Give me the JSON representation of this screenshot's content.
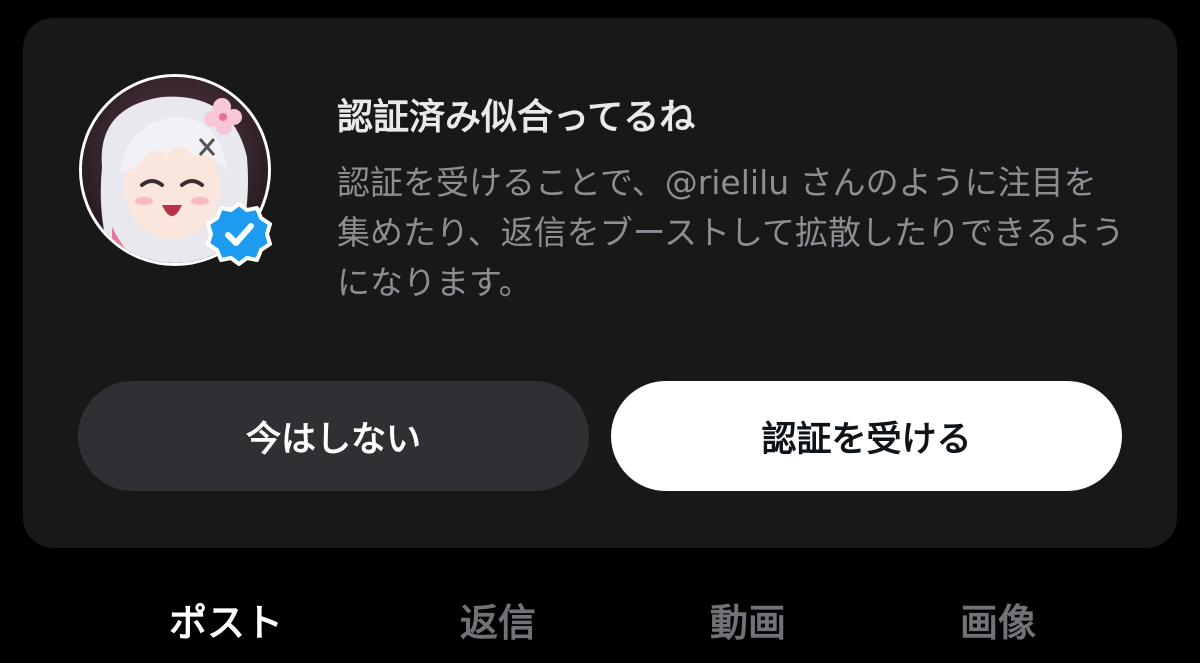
{
  "card": {
    "title": "認証済み似合ってるね",
    "description": "認証を受けることで、@rielilu さんのように注目を集めたり、返信をブーストして拡散したりできるようになります。"
  },
  "buttons": {
    "later_label": "今はしない",
    "verify_label": "認証を受ける"
  },
  "tabs": [
    {
      "label": "ポスト",
      "active": true
    },
    {
      "label": "返信",
      "active": false
    },
    {
      "label": "動画",
      "active": false
    },
    {
      "label": "画像",
      "active": false
    }
  ],
  "colors": {
    "background": "#000000",
    "card": "#181818",
    "verified_badge": "#1d9bf0",
    "primary_button": "#ffffff",
    "secondary_button": "#2f3033"
  },
  "icons": {
    "avatar": "anime-avatar",
    "badge": "verified-badge-icon"
  }
}
